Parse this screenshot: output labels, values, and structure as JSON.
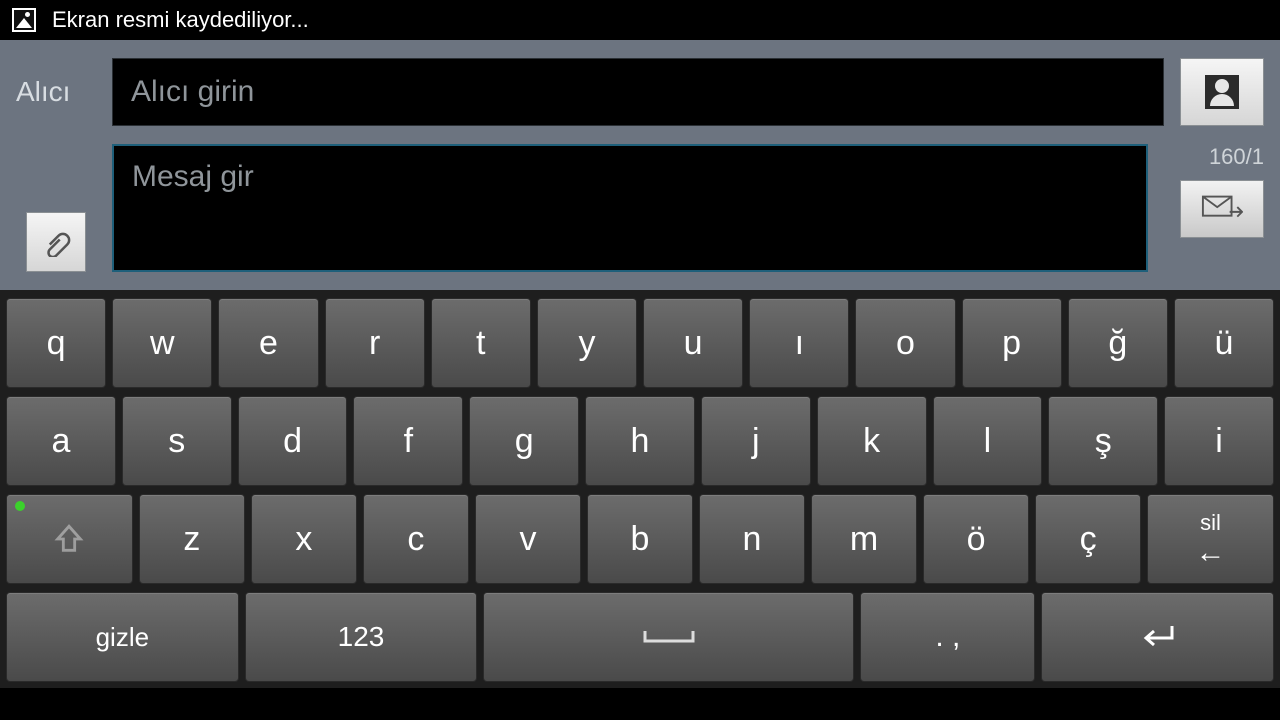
{
  "status": {
    "text": "Ekran resmi kaydediliyor..."
  },
  "compose": {
    "recipient_label": "Alıcı",
    "recipient_placeholder": "Alıcı girin",
    "message_placeholder": "Mesaj gir",
    "counter": "160/1"
  },
  "keyboard": {
    "row1": [
      "q",
      "w",
      "e",
      "r",
      "t",
      "y",
      "u",
      "ı",
      "o",
      "p",
      "ğ",
      "ü"
    ],
    "row2": [
      "a",
      "s",
      "d",
      "f",
      "g",
      "h",
      "j",
      "k",
      "l",
      "ş",
      "i"
    ],
    "row3_letters": [
      "z",
      "x",
      "c",
      "v",
      "b",
      "n",
      "m",
      "ö",
      "ç"
    ],
    "row3_delete": "sil",
    "row4": {
      "hide": "gizle",
      "numbers": "123",
      "punct": ". ,"
    }
  }
}
